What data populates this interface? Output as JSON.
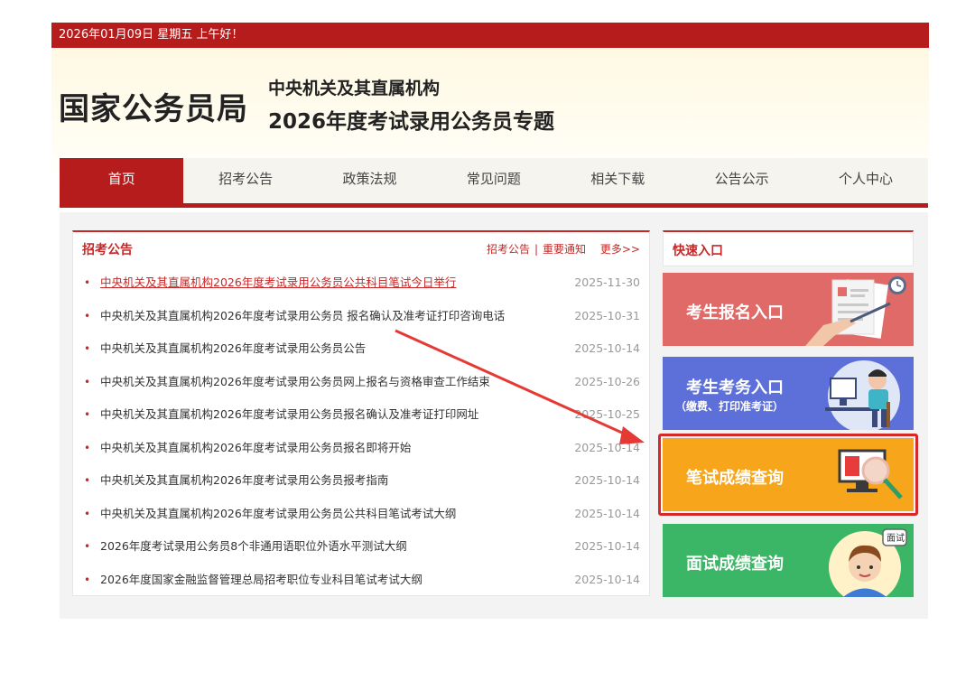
{
  "topbar": {
    "text": "2026年01月09日  星期五  上午好！"
  },
  "banner": {
    "logo": "国家公务员局",
    "subtitle1": "中央机关及其直属机构",
    "subtitle2": "2026年度考试录用公务员专题"
  },
  "nav": {
    "items": [
      {
        "label": "首页"
      },
      {
        "label": "招考公告"
      },
      {
        "label": "政策法规"
      },
      {
        "label": "常见问题"
      },
      {
        "label": "相关下载"
      },
      {
        "label": "公告公示"
      },
      {
        "label": "个人中心"
      }
    ]
  },
  "notice": {
    "title": "招考公告",
    "link1": "招考公告",
    "link2": "重要通知",
    "more": "更多>>",
    "items": [
      {
        "text": "中央机关及其直属机构2026年度考试录用公务员公共科目笔试今日举行",
        "date": "2025-11-30"
      },
      {
        "text": "中央机关及其直属机构2026年度考试录用公务员 报名确认及准考证打印咨询电话",
        "date": "2025-10-31"
      },
      {
        "text": "中央机关及其直属机构2026年度考试录用公务员公告",
        "date": "2025-10-14"
      },
      {
        "text": "中央机关及其直属机构2026年度考试录用公务员网上报名与资格审查工作结束",
        "date": "2025-10-26"
      },
      {
        "text": "中央机关及其直属机构2026年度考试录用公务员报名确认及准考证打印网址",
        "date": "2025-10-25"
      },
      {
        "text": "中央机关及其直属机构2026年度考试录用公务员报名即将开始",
        "date": "2025-10-14"
      },
      {
        "text": "中央机关及其直属机构2026年度考试录用公务员报考指南",
        "date": "2025-10-14"
      },
      {
        "text": "中央机关及其直属机构2026年度考试录用公务员公共科目笔试考试大纲",
        "date": "2025-10-14"
      },
      {
        "text": "2026年度考试录用公务员8个非通用语职位外语水平测试大纲",
        "date": "2025-10-14"
      },
      {
        "text": "2026年度国家金融监督管理总局招考职位专业科目笔试考试大纲",
        "date": "2025-10-14"
      }
    ]
  },
  "quick": {
    "title": "快速入口",
    "btn1": "考生报名入口",
    "btn2": "考生考务入口",
    "btn2_sub": "（缴费、打印准考证）",
    "btn3": "笔试成绩查询",
    "btn4": "面试成绩查询",
    "bubble": "面试"
  },
  "colors": {
    "brand_red": "#b71c1c",
    "q1": "#e06a68",
    "q2": "#5d6fd8",
    "q3": "#f7a51b",
    "q4": "#3bb566"
  }
}
